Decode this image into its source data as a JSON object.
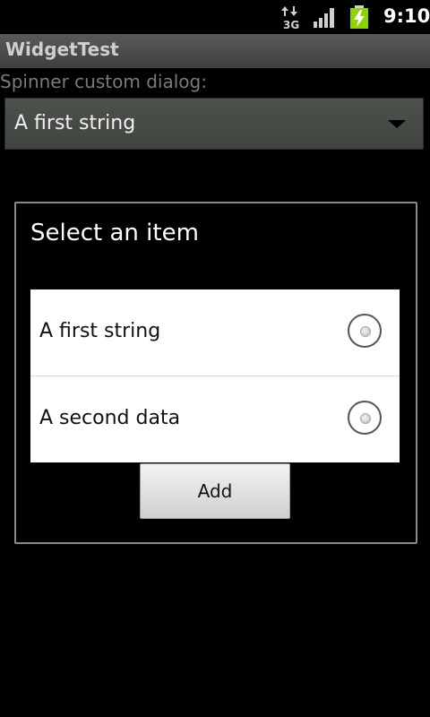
{
  "status_bar": {
    "network_icon": "3g-icon",
    "network_label": "3G",
    "signal_icon": "signal-icon",
    "battery_icon": "battery-charging-icon",
    "time": "9:10"
  },
  "app": {
    "title": "WidgetTest"
  },
  "spinner": {
    "label": "Spinner custom dialog:",
    "selected_value": "A first string",
    "arrow_icon": "dropdown-arrow-icon"
  },
  "dialog": {
    "title": "Select an item",
    "items": [
      {
        "label": "A first string",
        "selected": false
      },
      {
        "label": "A second data",
        "selected": false
      }
    ],
    "add_button_label": "Add"
  },
  "colors": {
    "battery_green": "#8cd300",
    "title_bar": "#4a4a4a",
    "background": "#000000"
  }
}
